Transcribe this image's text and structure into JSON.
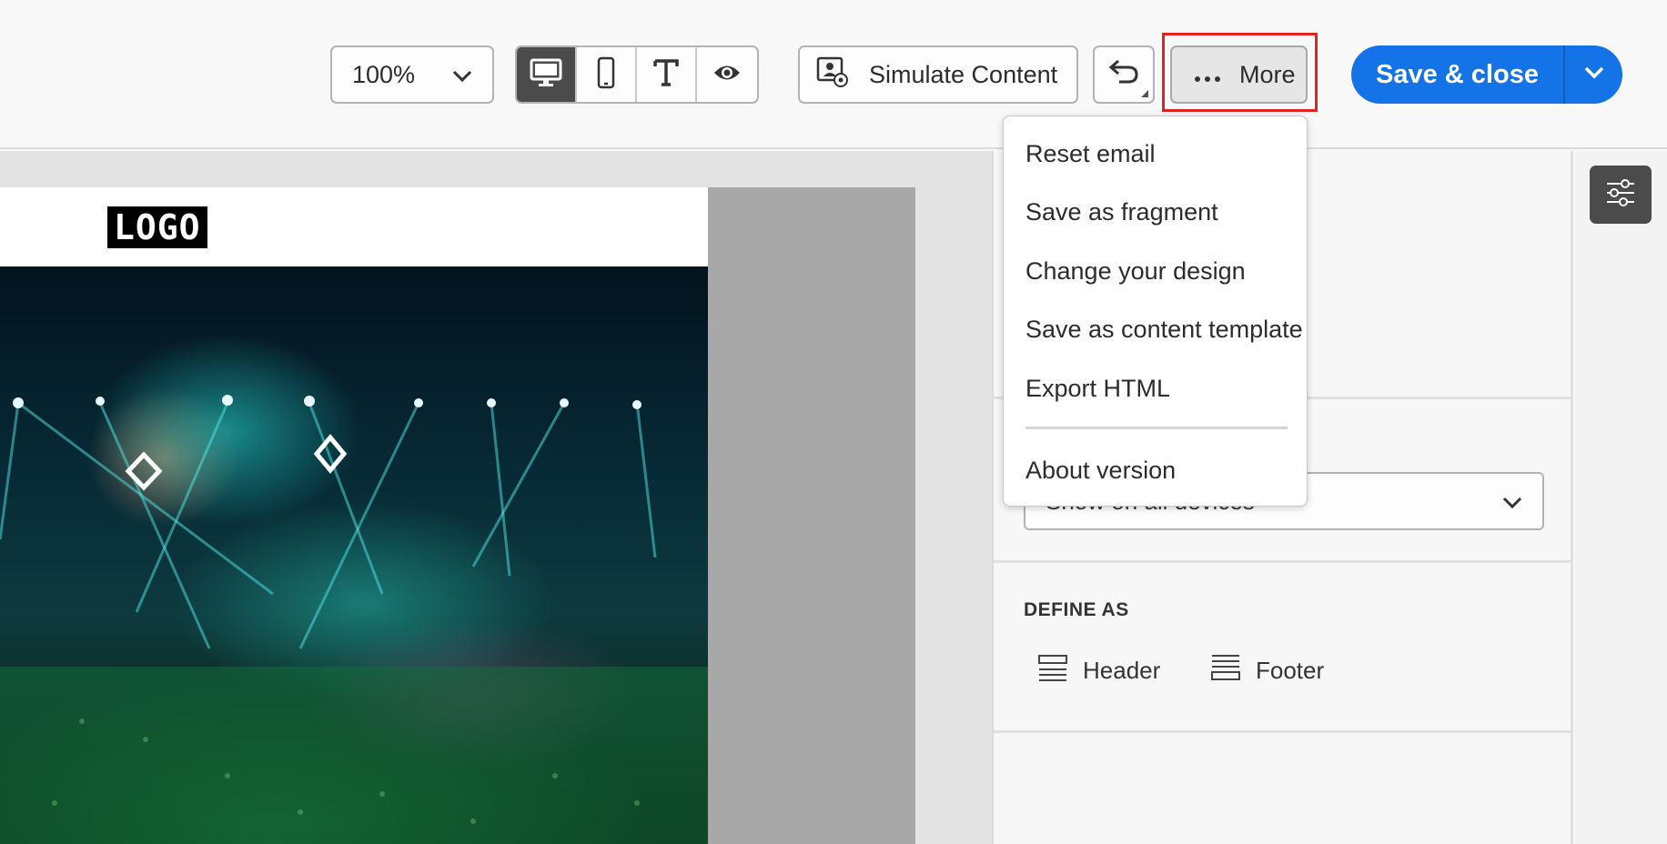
{
  "toolbar": {
    "zoom_value": "100%",
    "view_modes": [
      "desktop-icon",
      "mobile-icon",
      "text-icon",
      "preview-icon"
    ],
    "simulate_label": "Simulate Content",
    "more_label": "More",
    "save_label": "Save & close"
  },
  "canvas": {
    "logo_text": "LOGO"
  },
  "menu": {
    "items": [
      "Reset email",
      "Save as fragment",
      "Change your design",
      "Save as content template",
      "Export HTML",
      "About version"
    ]
  },
  "panel": {
    "visibility_value": "Show on all devices",
    "define_as_title": "DEFINE AS",
    "header_label": "Header",
    "footer_label": "Footer"
  },
  "colors": {
    "accent": "#1473e6",
    "highlight": "#e32222"
  }
}
